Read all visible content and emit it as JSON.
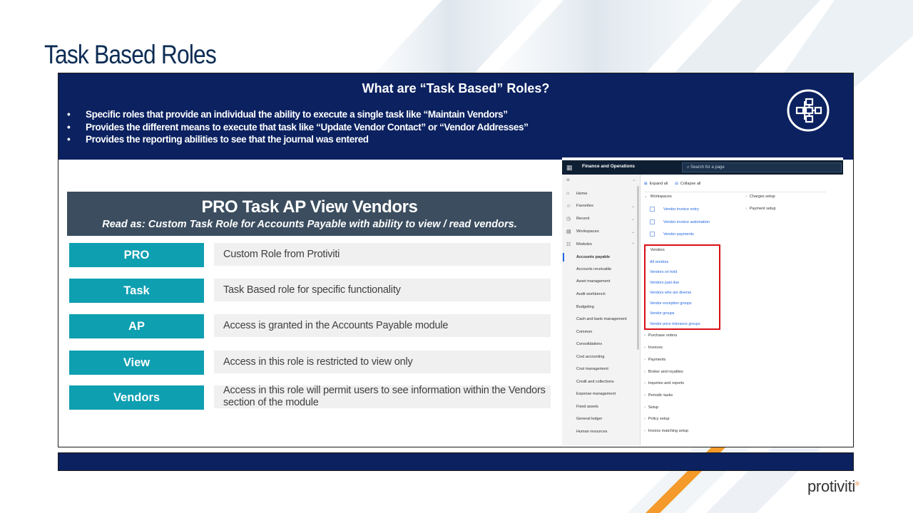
{
  "slide": {
    "title": "Task Based Roles",
    "brand": "protiviti",
    "brand_mark": "®"
  },
  "header": {
    "title": "What are “Task Based” Roles?",
    "icon": "workflow-hierarchy-icon",
    "bullets": [
      "Specific roles that provide an individual the ability to execute a single task like “Maintain Vendors”",
      "Provides the different means to execute that task like “Update Vendor Contact” or “Vendor Addresses”",
      "Provides the reporting abilities to see that the journal was entered"
    ]
  },
  "role": {
    "name": "PRO Task AP View Vendors",
    "read_as": "Read as: Custom Task Role for Accounts Payable with ability to view / read vendors.",
    "terms": [
      {
        "term": "PRO",
        "description": "Custom Role from Protiviti"
      },
      {
        "term": "Task",
        "description": "Task Based role for specific functionality"
      },
      {
        "term": "AP",
        "description": "Access is granted in the Accounts Payable module"
      },
      {
        "term": "View",
        "description": "Access in this role is restricted to view only"
      },
      {
        "term": "Vendors",
        "description": "Access in this role will permit users to see information within the Vendors section of the module"
      }
    ]
  },
  "d365": {
    "app_name": "Finance and Operations",
    "search_placeholder": "Search for a page",
    "nav_top": [
      {
        "label": "Home",
        "icon": "home-icon"
      },
      {
        "label": "Favorites",
        "icon": "star-icon"
      },
      {
        "label": "Recent",
        "icon": "clock-icon"
      },
      {
        "label": "Workspaces",
        "icon": "grid-icon"
      },
      {
        "label": "Modules",
        "icon": "list-icon"
      }
    ],
    "modules": [
      "Accounts payable",
      "Accounts receivable",
      "Asset management",
      "Audit workbench",
      "Budgeting",
      "Cash and bank management",
      "Common",
      "Consolidations",
      "Cost accounting",
      "Cost management",
      "Credit and collections",
      "Expense management",
      "Fixed assets",
      "General ledger",
      "Human resources"
    ],
    "toolbar": {
      "expand_all": "Expand all",
      "collapse_all": "Collapse all"
    },
    "workspaces_label": "Workspaces",
    "workspace_links": [
      "Vendor invoice entry",
      "Vendor invoice automation",
      "Vendor payments"
    ],
    "right_links": [
      "Charges setup",
      "Payment setup"
    ],
    "vendors_label": "Vendors",
    "vendor_links": [
      "All vendors",
      "Vendors on hold",
      "Vendors past due",
      "Vendors who are diverse",
      "Vendor exception groups",
      "Vendor groups",
      "Vendor price tolerance groups"
    ],
    "sections": [
      "Purchase orders",
      "Invoices",
      "Payments",
      "Broker and royalties",
      "Inquiries and reports",
      "Periodic tasks",
      "Setup",
      "Policy setup",
      "Invoice matching setup"
    ]
  },
  "colors": {
    "navy": "#0b2160",
    "teal": "#0e9fb1",
    "slate": "#3b4d5f",
    "title": "#0d2c54",
    "highlight_red": "#d90f16",
    "accent_orange": "#f39a2b"
  }
}
